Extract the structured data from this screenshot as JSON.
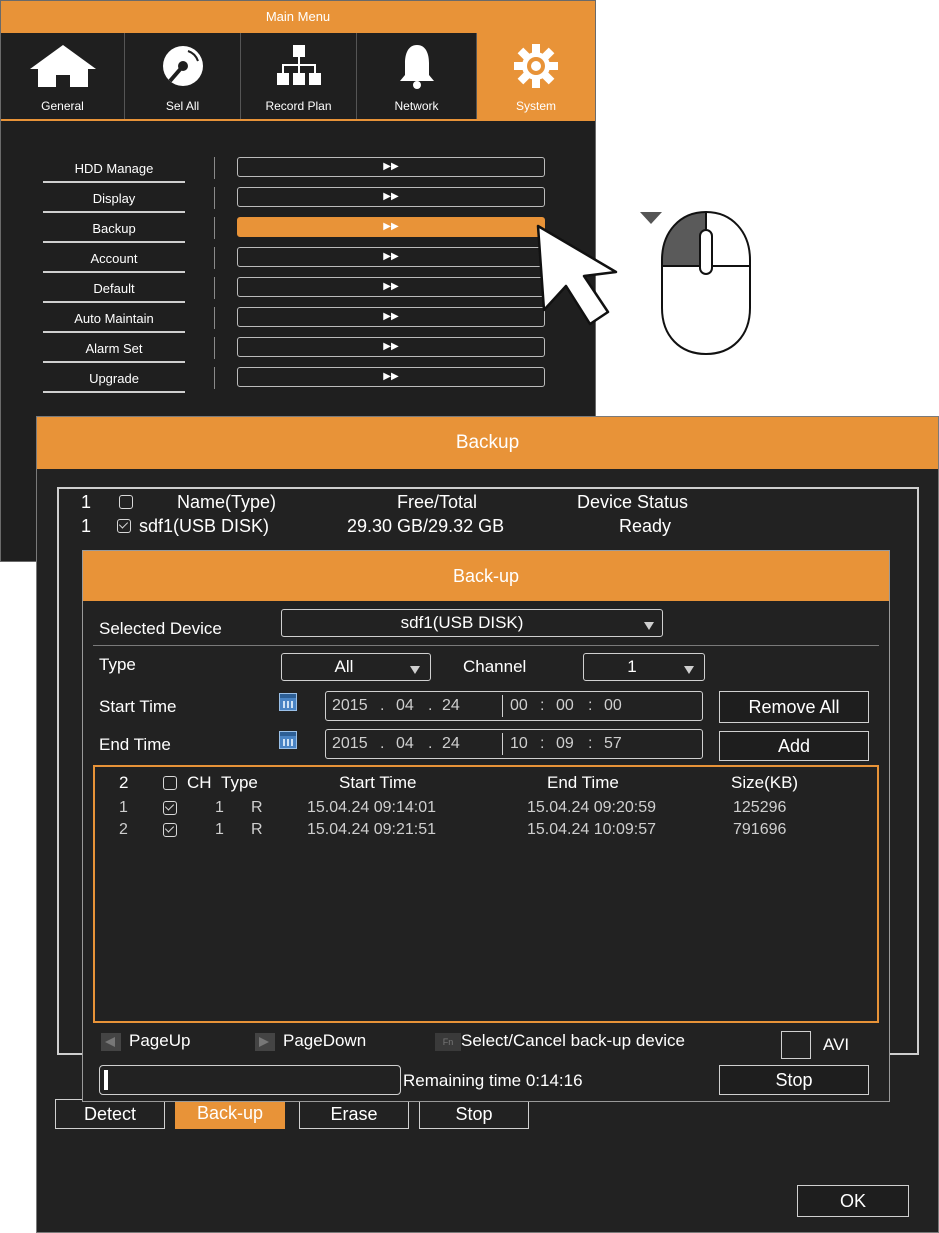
{
  "main_menu": {
    "title": "Main Menu",
    "tabs": [
      {
        "label": "General",
        "icon": "home-icon"
      },
      {
        "label": "Sel All",
        "icon": "disc-icon"
      },
      {
        "label": "Record Plan",
        "icon": "network-tree-icon"
      },
      {
        "label": "Network",
        "icon": "bell-icon"
      },
      {
        "label": "System",
        "icon": "gear-icon",
        "active": true
      }
    ],
    "items": [
      {
        "label": "HDD Manage",
        "arrow": "▶▶"
      },
      {
        "label": "Display",
        "arrow": "▶▶"
      },
      {
        "label": "Backup",
        "arrow": "▶▶",
        "selected": true
      },
      {
        "label": "Account",
        "arrow": "▶▶"
      },
      {
        "label": "Default",
        "arrow": "▶▶"
      },
      {
        "label": "Auto Maintain",
        "arrow": "▶▶"
      },
      {
        "label": "Alarm Set",
        "arrow": "▶▶"
      },
      {
        "label": "Upgrade",
        "arrow": "▶▶"
      }
    ]
  },
  "backup": {
    "title": "Backup",
    "device_table": {
      "count": "1",
      "headers": {
        "name": "Name(Type)",
        "free_total": "Free/Total",
        "status": "Device Status"
      },
      "rows": [
        {
          "index": "1",
          "name": "sdf1(USB DISK)",
          "free_total": "29.30 GB/29.32 GB",
          "status": "Ready",
          "checked": true
        }
      ]
    },
    "buttons": {
      "detect": "Detect",
      "backup": "Back-up",
      "erase": "Erase",
      "stop": "Stop",
      "ok": "OK"
    }
  },
  "dialog": {
    "title": "Back-up",
    "selected_device_label": "Selected Device",
    "selected_device_value": "sdf1(USB DISK)",
    "type_label": "Type",
    "type_value": "All",
    "channel_label": "Channel",
    "channel_value": "1",
    "start_time_label": "Start Time",
    "start_date": {
      "y": "2015",
      "m": "04",
      "d": "24"
    },
    "start_clock": {
      "h": "00",
      "m": "00",
      "s": "00"
    },
    "end_time_label": "End Time",
    "end_date": {
      "y": "2015",
      "m": "04",
      "d": "24"
    },
    "end_clock": {
      "h": "10",
      "m": "09",
      "s": "57"
    },
    "remove_all_label": "Remove All",
    "add_label": "Add",
    "records": {
      "count": "2",
      "headers": {
        "ch": "CH",
        "type": "Type",
        "start": "Start Time",
        "end": "End Time",
        "size": "Size(KB)"
      },
      "rows": [
        {
          "index": "1",
          "ch": "1",
          "type": "R",
          "start": "15.04.24 09:14:01",
          "end": "15.04.24 09:20:59",
          "size": "125296",
          "checked": true
        },
        {
          "index": "2",
          "ch": "1",
          "type": "R",
          "start": "15.04.24 09:21:51",
          "end": "15.04.24 10:09:57",
          "size": "791696",
          "checked": true
        }
      ]
    },
    "page_up": "PageUp",
    "page_down": "PageDown",
    "fn_key": "Fn",
    "select_cancel_label": "Select/Cancel back-up device",
    "avi_label": "AVI",
    "progress_fraction": 0.01,
    "remaining_time": "Remaining time 0:14:16",
    "stop_label": "Stop"
  },
  "colors": {
    "accent": "#e89338",
    "panel": "#222222"
  }
}
